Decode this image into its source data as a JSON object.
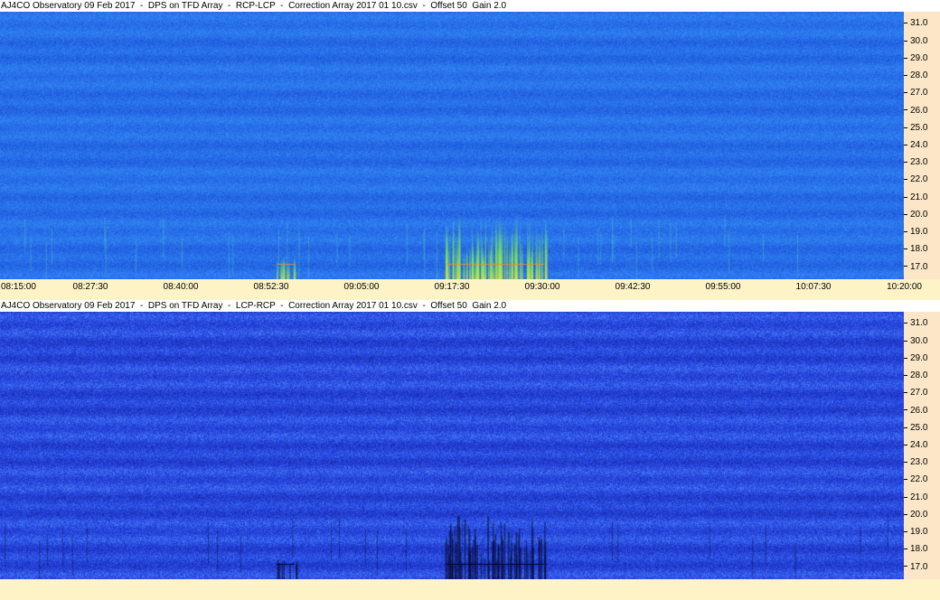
{
  "chart_data": [
    {
      "type": "heatmap",
      "title": "AJ4CO Observatory 09 Feb 2017  -  DPS on TFD Array  -  RCP-LCP  -  Correction Array 2017 01 10.csv  -  Offset 50  Gain 2.0",
      "y_ticks": [
        "31.0",
        "30.0",
        "29.0",
        "28.0",
        "27.0",
        "26.0",
        "25.0",
        "24.0",
        "23.0",
        "22.0",
        "21.0",
        "20.0",
        "19.0",
        "18.0",
        "17.0"
      ],
      "ylim": [
        16.3,
        31.7
      ],
      "x_ticks": [
        "08:15:00",
        "08:27:30",
        "08:40:00",
        "08:52:30",
        "09:05:00",
        "09:17:30",
        "09:30:00",
        "09:42:30",
        "09:55:00",
        "10:07:30",
        "10:20:00"
      ],
      "xlim": [
        "08:15:00",
        "10:20:00"
      ],
      "colormap": [
        "#1a4fd6",
        "#2e7df0",
        "#3fa8f5",
        "#3fe0c0",
        "#7ae640",
        "#f2e040",
        "#f08a30"
      ],
      "bursts": [
        {
          "time": "09:16:30",
          "end": "09:30:30",
          "freq_top": 20.3,
          "note": "emission cluster"
        },
        {
          "time": "08:53:00",
          "end": "08:56:00",
          "freq_top": 17.4,
          "note": "short arc"
        }
      ]
    },
    {
      "type": "heatmap",
      "title": "AJ4CO Observatory 09 Feb 2017  -  DPS on TFD Array  -  LCP-RCP  -  Correction Array 2017 01 10.csv  -  Offset 50  Gain 2.0",
      "y_ticks": [
        "31.0",
        "30.0",
        "29.0",
        "28.0",
        "27.0",
        "26.0",
        "25.0",
        "24.0",
        "23.0",
        "22.0",
        "21.0",
        "20.0",
        "19.0",
        "18.0",
        "17.0"
      ],
      "ylim": [
        16.3,
        31.7
      ],
      "x_ticks": [],
      "colormap": [
        "#0a1a5c",
        "#1c33c0",
        "#2746e0",
        "#3d6cf0",
        "#5f9af5"
      ]
    }
  ]
}
